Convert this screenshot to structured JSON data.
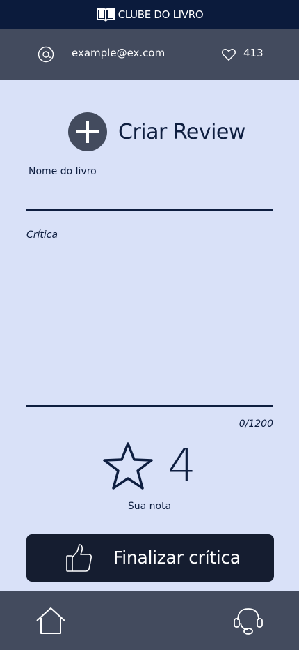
{
  "header": {
    "title": "CLUBE DO LIVRO",
    "icon": "book-icon"
  },
  "user": {
    "email": "example@ex.com",
    "likes": "413",
    "email_icon": "at-icon",
    "likes_icon": "heart-icon"
  },
  "create": {
    "title": "Criar Review",
    "icon": "plus-icon"
  },
  "form": {
    "book_name_label": "Nome do livro",
    "book_name_value": "",
    "review_label": "Crítica",
    "review_value": "",
    "char_count": "0/1200"
  },
  "rating": {
    "value": "4",
    "label": "Sua nota",
    "icon": "star-icon"
  },
  "submit": {
    "label": "Finalizar crítica",
    "icon": "thumbs-up-icon"
  },
  "nav": {
    "home_icon": "home-icon",
    "support_icon": "headset-icon"
  },
  "colors": {
    "dark_navy": "#0b1b3c",
    "slate": "#434b5e",
    "background": "#d9e1f8",
    "button": "#151d30",
    "text": "#0e1e40"
  }
}
